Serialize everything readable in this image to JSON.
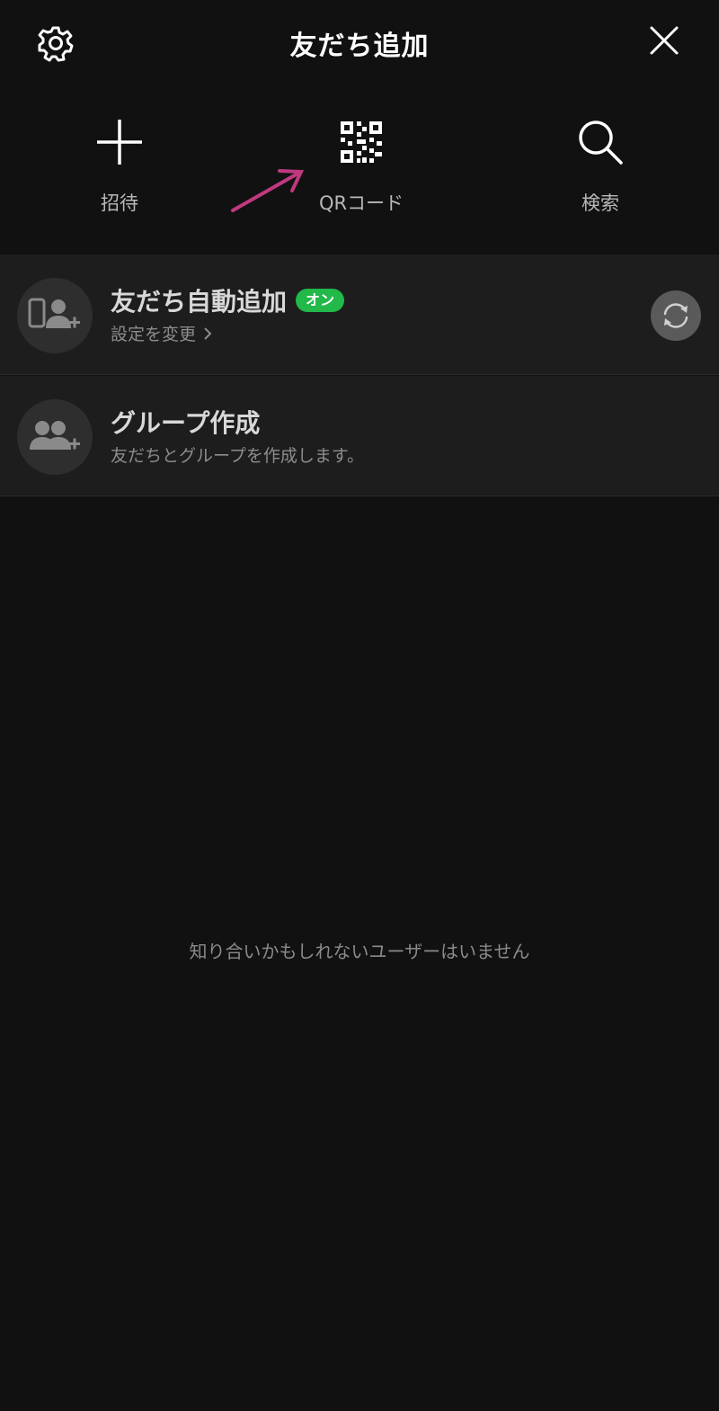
{
  "header": {
    "title": "友だち追加",
    "settings_icon": "gear-icon",
    "close_icon": "close-icon"
  },
  "actions": [
    {
      "label": "招待",
      "icon": "plus-icon"
    },
    {
      "label": "QRコード",
      "icon": "qr-code-icon"
    },
    {
      "label": "検索",
      "icon": "search-icon"
    }
  ],
  "auto_add": {
    "title": "友だち自動追加",
    "badge": "オン",
    "subtitle": "設定を変更",
    "icon": "phone-user-add-icon",
    "refresh_icon": "refresh-icon"
  },
  "group": {
    "title": "グループ作成",
    "subtitle": "友だちとグループを作成します。",
    "icon": "group-add-icon"
  },
  "empty_message": "知り合いかもしれないユーザーはいません",
  "colors": {
    "background": "#111111",
    "row_background": "#1d1d1d",
    "badge_green": "#22b84a",
    "annotation_arrow": "#c0397f"
  }
}
